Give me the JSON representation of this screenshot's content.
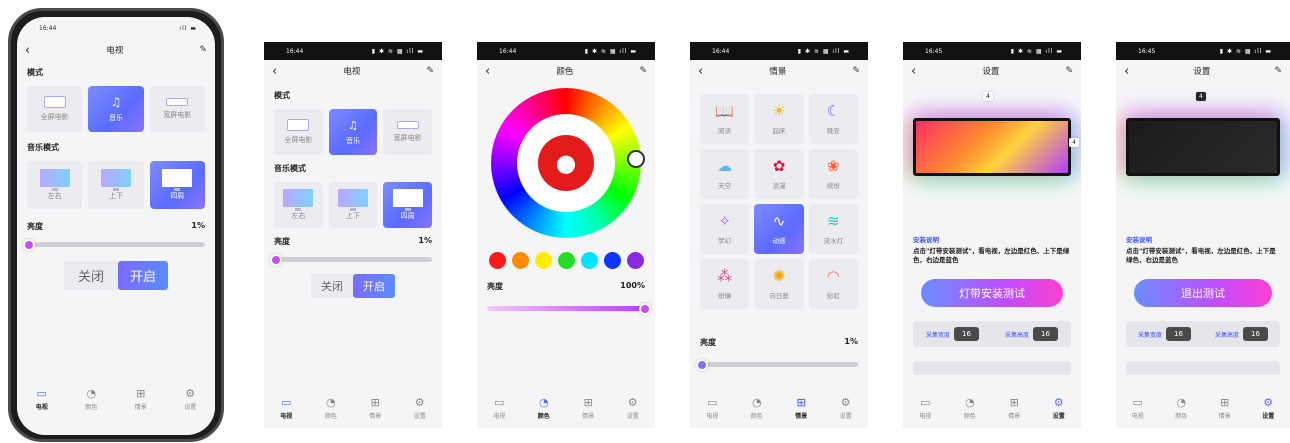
{
  "time": [
    "16:44",
    "16:44",
    "16:44",
    "16:44",
    "16:45",
    "16:45"
  ],
  "status_icons": "▮ ✱ ≋ ▦ ıll ▬",
  "frame_status_icons": "ıll ▬",
  "titles": {
    "tv": "电视",
    "color": "颜色",
    "scene": "情景",
    "settings": "设置"
  },
  "tv": {
    "mode_label": "模式",
    "modes": [
      "全屏电影",
      "音乐",
      "宽屏电影"
    ],
    "music_mode_label": "音乐模式",
    "music_modes": [
      "左右",
      "上下",
      "四周"
    ],
    "brightness_label": "亮度",
    "brightness_value": "1%",
    "brightness_fraction": 0.01,
    "toggle_off": "关闭",
    "toggle_on": "开启"
  },
  "color": {
    "swatches": [
      "#ff1a1a",
      "#ff8a00",
      "#ffee00",
      "#22dd22",
      "#00e5ff",
      "#1133ff",
      "#8a2be2"
    ],
    "brightness_label": "亮度",
    "brightness_value": "100%",
    "brightness_fraction": 1.0
  },
  "scene": {
    "items": [
      {
        "label": "阅读",
        "icon": "book-icon"
      },
      {
        "label": "起床",
        "icon": "sunrise-icon"
      },
      {
        "label": "晚安",
        "icon": "moon-icon"
      },
      {
        "label": "天空",
        "icon": "cloud-icon"
      },
      {
        "label": "浪漫",
        "icon": "rose-icon"
      },
      {
        "label": "缤纷",
        "icon": "flower-icon"
      },
      {
        "label": "梦幻",
        "icon": "sparkle-wand-icon"
      },
      {
        "label": "动感",
        "icon": "wave-pulse-icon"
      },
      {
        "label": "流水灯",
        "icon": "water-wave-icon"
      },
      {
        "label": "斑斓",
        "icon": "confetti-icon"
      },
      {
        "label": "向日葵",
        "icon": "sunflower-icon"
      },
      {
        "label": "彩虹",
        "icon": "rainbow-icon"
      }
    ],
    "brightness_label": "亮度",
    "brightness_value": "1%",
    "brightness_fraction": 0.01
  },
  "settings": {
    "badge_top": "4",
    "badge_right": "4",
    "instruction_title": "安装说明",
    "instruction_text": "点击\"灯带安装测试\"，看电视，左边是红色、上下是绿色，右边是蓝色",
    "test_button": "灯带安装测试",
    "exit_button": "退出测试",
    "width_label": "采集宽度",
    "width_value": "16",
    "height_label": "采集高度",
    "height_value": "16"
  },
  "tabs": [
    {
      "label": "电视",
      "icon": "tv-icon"
    },
    {
      "label": "颜色",
      "icon": "palette-icon"
    },
    {
      "label": "情景",
      "icon": "grid-icon"
    },
    {
      "label": "设置",
      "icon": "gear-icon"
    }
  ]
}
